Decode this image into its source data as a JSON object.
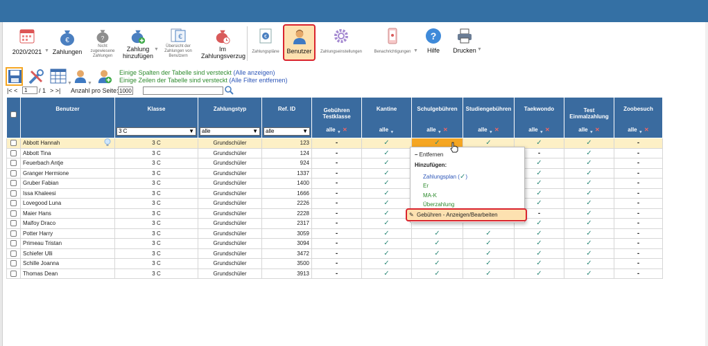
{
  "toolbar": {
    "year": "2020/2021",
    "zahlungen": "Zahlungen",
    "nicht_zugewiesen_1": "Nicht",
    "nicht_zugewiesen_2": "zugewiesene",
    "nicht_zugewiesen_3": "Zahlungen",
    "zahlung_hinzufuegen_1": "Zahlung",
    "zahlung_hinzufuegen_2": "hinzufügen",
    "uebersicht_1": "Übersicht der",
    "uebersicht_2": "Zahlungen von",
    "uebersicht_3": "Benutzern",
    "verzug_1": "Im",
    "verzug_2": "Zahlungsverzug",
    "zahlungsplaene": "Zahlungspläne",
    "benutzer": "Benutzer",
    "zahlungseinstellungen": "Zahlungseinstellungen",
    "benachrichtigungen": "Benachrichtigungen",
    "hilfe": "Hilfe",
    "drucken": "Drucken"
  },
  "notices": {
    "cols_text": "Einige Spalten der Tabelle sind versteckt",
    "cols_link": "(Alle anzeigen)",
    "rows_text": "Einige Zeilen der Tabelle sind versteckt",
    "rows_link": "(Alle Filter entfernen)"
  },
  "pager": {
    "nav_left": "|< <",
    "page": "1",
    "of": "/ 1",
    "nav_right": "> >|",
    "per_page_label": "Anzahl pro Seite:",
    "per_page": "1000"
  },
  "columns": {
    "benutzer": "Benutzer",
    "klasse": "Klasse",
    "zahlungstyp": "Zahlungstyp",
    "refid": "Ref. ID",
    "gebuehren_1": "Gebühren",
    "gebuehren_2": "Testklasse",
    "kantine": "Kantine",
    "schulgebuehren": "Schulgebühren",
    "studiengebuehren": "Studiengebühren",
    "taekwondo": "Taekwondo",
    "test_1": "Test",
    "test_2": "Einmalzahlung",
    "zoobesuch": "Zoobesuch"
  },
  "filters": {
    "klasse": "3 C",
    "zahlungstyp": "alle",
    "refid": "alle",
    "alle": "alle"
  },
  "rows": [
    {
      "name": "Abbott Hannah",
      "klasse": "3 C",
      "typ": "Grundschüler",
      "ref": "123",
      "g": "-",
      "k": "✓",
      "s": "✓",
      "st": "✓",
      "t": "✓",
      "te": "✓",
      "z": "-"
    },
    {
      "name": "Abbott Tina",
      "klasse": "3 C",
      "typ": "Grundschüler",
      "ref": "124",
      "g": "-",
      "k": "✓",
      "s": "",
      "st": "",
      "t": "-",
      "te": "✓",
      "z": "-"
    },
    {
      "name": "Feuerbach Antje",
      "klasse": "3 C",
      "typ": "Grundschüler",
      "ref": "924",
      "g": "-",
      "k": "✓",
      "s": "",
      "st": "",
      "t": "✓",
      "te": "✓",
      "z": "-"
    },
    {
      "name": "Granger Hermione",
      "klasse": "3 C",
      "typ": "Grundschüler",
      "ref": "1337",
      "g": "-",
      "k": "✓",
      "s": "",
      "st": "",
      "t": "✓",
      "te": "✓",
      "z": "-"
    },
    {
      "name": "Gruber Fabian",
      "klasse": "3 C",
      "typ": "Grundschüler",
      "ref": "1400",
      "g": "-",
      "k": "✓",
      "s": "",
      "st": "",
      "t": "✓",
      "te": "✓",
      "z": "-"
    },
    {
      "name": "Issa Khaleesi",
      "klasse": "3 C",
      "typ": "Grundschüler",
      "ref": "1666",
      "g": "-",
      "k": "✓",
      "s": "",
      "st": "",
      "t": "✓",
      "te": "✓",
      "z": "-"
    },
    {
      "name": "Lovegood Luna",
      "klasse": "3 C",
      "typ": "Grundschüler",
      "ref": "2226",
      "g": "-",
      "k": "✓",
      "s": "",
      "st": "",
      "t": "✓",
      "te": "✓",
      "z": "-"
    },
    {
      "name": "Maier Hans",
      "klasse": "3 C",
      "typ": "Grundschüler",
      "ref": "2228",
      "g": "-",
      "k": "✓",
      "s": "",
      "st": "",
      "t": "-",
      "te": "✓",
      "z": "-"
    },
    {
      "name": "Malfoy Draco",
      "klasse": "3 C",
      "typ": "Grundschüler",
      "ref": "2317",
      "g": "-",
      "k": "✓",
      "s": "",
      "st": "",
      "t": "✓",
      "te": "✓",
      "z": "-"
    },
    {
      "name": "Potter Harry",
      "klasse": "3 C",
      "typ": "Grundschüler",
      "ref": "3059",
      "g": "-",
      "k": "✓",
      "s": "✓",
      "st": "✓",
      "t": "✓",
      "te": "✓",
      "z": "-"
    },
    {
      "name": "Primeau Tristan",
      "klasse": "3 C",
      "typ": "Grundschüler",
      "ref": "3094",
      "g": "-",
      "k": "✓",
      "s": "✓",
      "st": "✓",
      "t": "✓",
      "te": "✓",
      "z": "-"
    },
    {
      "name": "Schiefer Ulli",
      "klasse": "3 C",
      "typ": "Grundschüler",
      "ref": "3472",
      "g": "-",
      "k": "✓",
      "s": "✓",
      "st": "✓",
      "t": "✓",
      "te": "✓",
      "z": "-"
    },
    {
      "name": "Schille Joanna",
      "klasse": "3 C",
      "typ": "Grundschüler",
      "ref": "3500",
      "g": "-",
      "k": "✓",
      "s": "✓",
      "st": "✓",
      "t": "✓",
      "te": "✓",
      "z": "-"
    },
    {
      "name": "Thomas Dean",
      "klasse": "3 C",
      "typ": "Grundschüler",
      "ref": "3913",
      "g": "-",
      "k": "✓",
      "s": "✓",
      "st": "✓",
      "t": "✓",
      "te": "✓",
      "z": "-"
    }
  ],
  "popup": {
    "entfernen": "Entfernen",
    "hinzufuegen": "Hinzufügen:",
    "zahlungsplan": "Zahlungsplan",
    "er": "Er",
    "mak": "MA-K",
    "ueberzahlung": "Überzahlung",
    "bearbeiten": "Gebühren - Anzeigen/Bearbeiten"
  },
  "colors": {
    "header": "#3a6b9f",
    "accent": "#f5a623",
    "highlight": "#d9232d"
  }
}
